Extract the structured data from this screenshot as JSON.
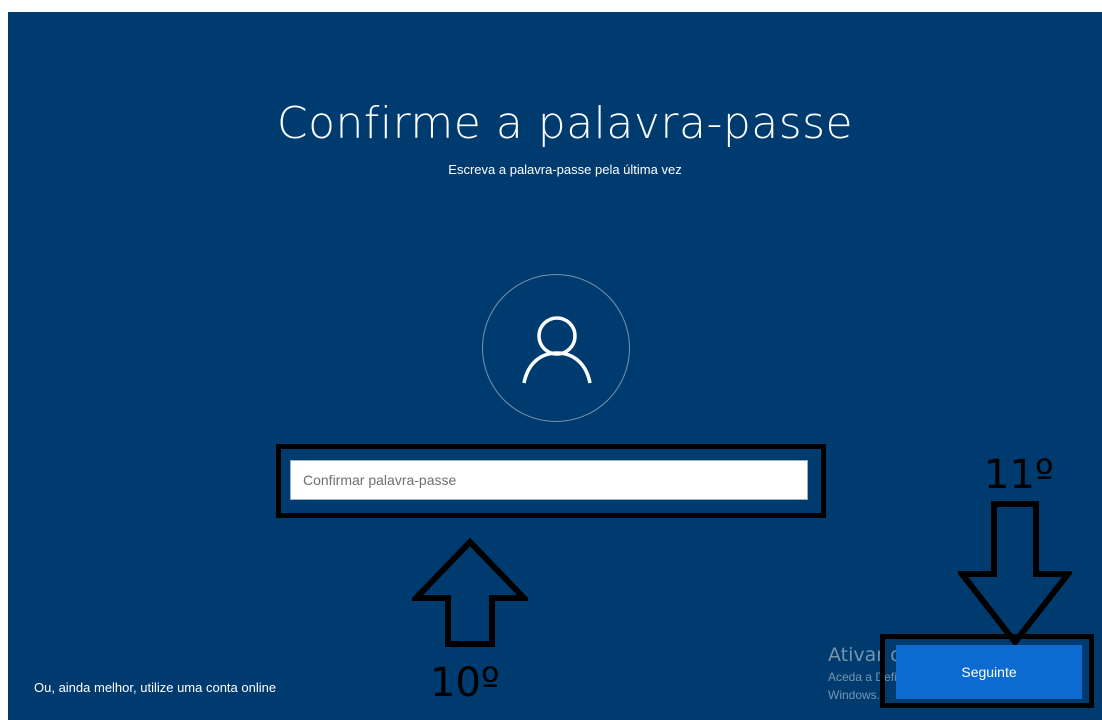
{
  "screen": {
    "title": "Confirme a palavra-passe",
    "subtitle": "Escreva a palavra-passe pela última vez",
    "avatar_icon": "user-icon",
    "password_input": {
      "placeholder": "Confirmar palavra-passe",
      "value": ""
    },
    "online_account_link": "Ou, ainda melhor, utilize uma conta online",
    "next_button": "Seguinte",
    "activation_watermark": {
      "title": "Ativar o Windows",
      "line1": "Aceda a Definições para ativar o",
      "line2": "Windows."
    },
    "background_color": "#003b6f",
    "button_color": "#0b6bd0"
  },
  "annotations": {
    "step10_label": "10º",
    "step11_label": "11º",
    "step10_arrow_icon": "arrow-up-icon",
    "step11_arrow_icon": "arrow-down-icon"
  }
}
